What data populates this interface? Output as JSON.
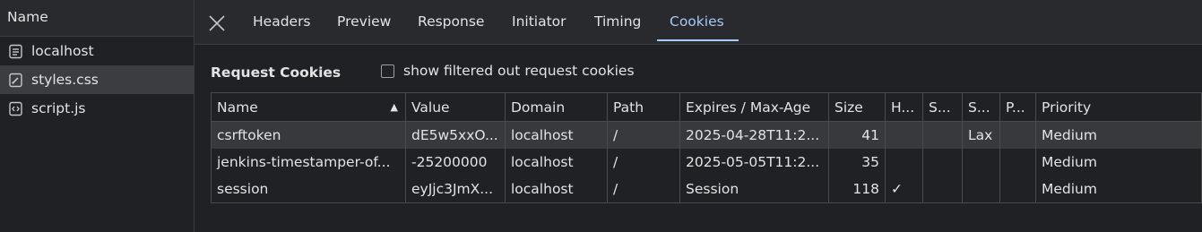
{
  "request_list": {
    "header": "Name",
    "items": [
      {
        "label": "localhost",
        "icon": "document-icon",
        "selected": false
      },
      {
        "label": "styles.css",
        "icon": "stylesheet-icon",
        "selected": true
      },
      {
        "label": "script.js",
        "icon": "script-icon",
        "selected": false
      }
    ]
  },
  "tabs": [
    "Headers",
    "Preview",
    "Response",
    "Initiator",
    "Timing",
    "Cookies"
  ],
  "active_tab": "Cookies",
  "section": {
    "title": "Request Cookies",
    "checkbox_label": "show filtered out request cookies"
  },
  "table": {
    "columns": [
      "Name",
      "Value",
      "Domain",
      "Path",
      "Expires / Max-Age",
      "Size",
      "H...",
      "S...",
      "S...",
      "P...",
      "Priority"
    ],
    "sort_indicator": "▲",
    "rows": [
      [
        "csrftoken",
        "dE5w5xxO...",
        "localhost",
        "/",
        "2025-04-28T11:2...",
        "41",
        "",
        "",
        "Lax",
        "",
        "Medium"
      ],
      [
        "jenkins-timestamper-of...",
        "-25200000",
        "localhost",
        "/",
        "2025-05-05T11:2...",
        "35",
        "",
        "",
        "",
        "",
        "Medium"
      ],
      [
        "session",
        "eyJjc3JmX...",
        "localhost",
        "/",
        "Session",
        "118",
        "✓",
        "",
        "",
        "",
        "Medium"
      ]
    ]
  },
  "colors": {
    "background": "#202124",
    "accent": "#a8c7fa",
    "border": "#4a4a4a"
  }
}
